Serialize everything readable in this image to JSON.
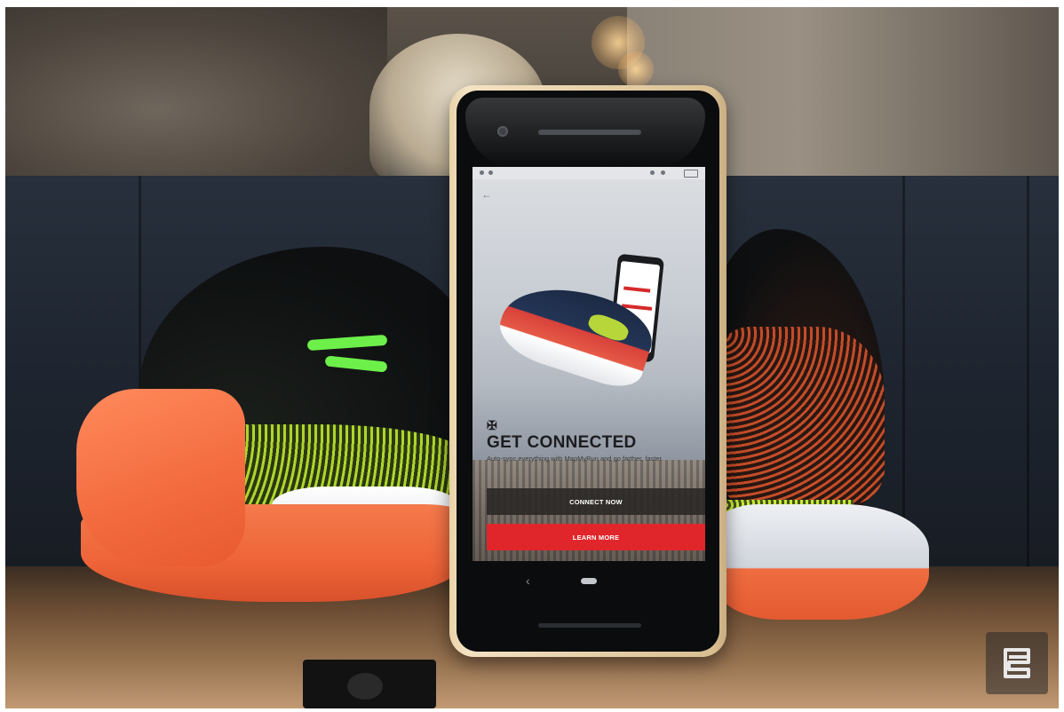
{
  "scene": {
    "description_type": "product-photo",
    "accent_colors": {
      "shoe_orange": "#f26a3e",
      "shoe_lime": "#b5e02c",
      "app_red": "#e0262b",
      "phone_case": "#e8d2a8"
    }
  },
  "app_screen": {
    "brand_icon": "under-armour-logo",
    "headline": "GET CONNECTED",
    "subtext": "Auto-sync everything with MapMyRun and go farther, faster.",
    "connect_button_label": "CONNECT NOW",
    "learn_button_label": "LEARN MORE"
  },
  "watermark": {
    "icon": "engadget-e-logo"
  }
}
